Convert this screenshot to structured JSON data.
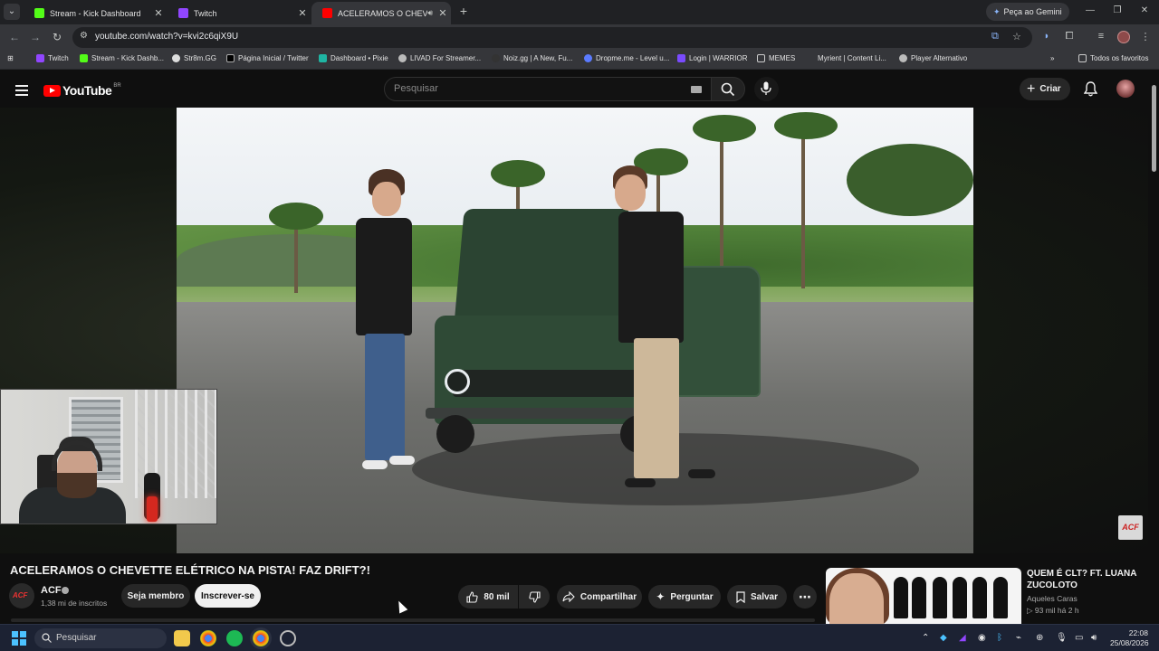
{
  "browser": {
    "tabs": [
      {
        "title": "Stream - Kick Dashboard",
        "favicon_color": "#53fc18"
      },
      {
        "title": "Twitch",
        "favicon_color": "#9146ff"
      },
      {
        "title": "ACELERAMOS O CHEVETTE",
        "favicon_color": "#ff0000",
        "active": true
      }
    ],
    "gemini_label": "Peça ao Gemini",
    "url": "youtube.com/watch?v=kvi2c6qiX9U",
    "bookmarks": [
      "Twitch",
      "Stream - Kick Dashb...",
      "Str8m.GG",
      "Página Inicial / Twitter",
      "Dashboard • Pixie",
      "LIVAD For Streamer...",
      "Noiz.gg | A New, Fu...",
      "Dropme.me - Level u...",
      "Login | WARRIOR",
      "MEMES",
      "Myrient | Content Li...",
      "Player Alternativo"
    ],
    "all_bookmarks": "Todos os favoritos"
  },
  "youtube": {
    "logo_word": "YouTube",
    "country": "BR",
    "search_placeholder": "Pesquisar",
    "create_label": "Criar",
    "watermark": "ACF"
  },
  "video": {
    "title": "ACELERAMOS O CHEVETTE ELÉTRICO NA PISTA! FAZ DRIFT?!",
    "channel_name": "ACF",
    "channel_avatar_text": "ACF",
    "subscribers": "1,38 mi de inscritos",
    "member_label": "Seja membro",
    "subscribe_label": "Inscrever-se",
    "likes": "80 mil",
    "share_label": "Compartilhar",
    "ask_label": "Perguntar",
    "save_label": "Salvar"
  },
  "recommendation": {
    "title": "QUEM É CLT? FT. LUANA ZUCOLOTO",
    "channel": "Aqueles Caras",
    "meta": "▷ 93 mil   há 2 h"
  },
  "taskbar": {
    "search_placeholder": "Pesquisar",
    "time": "22:08",
    "date": "25/08/2026"
  },
  "colors": {
    "accent_red": "#ff0000",
    "kick_green": "#53fc18",
    "twitch_purple": "#9146ff",
    "windows_blue": "#4cc2ff"
  }
}
